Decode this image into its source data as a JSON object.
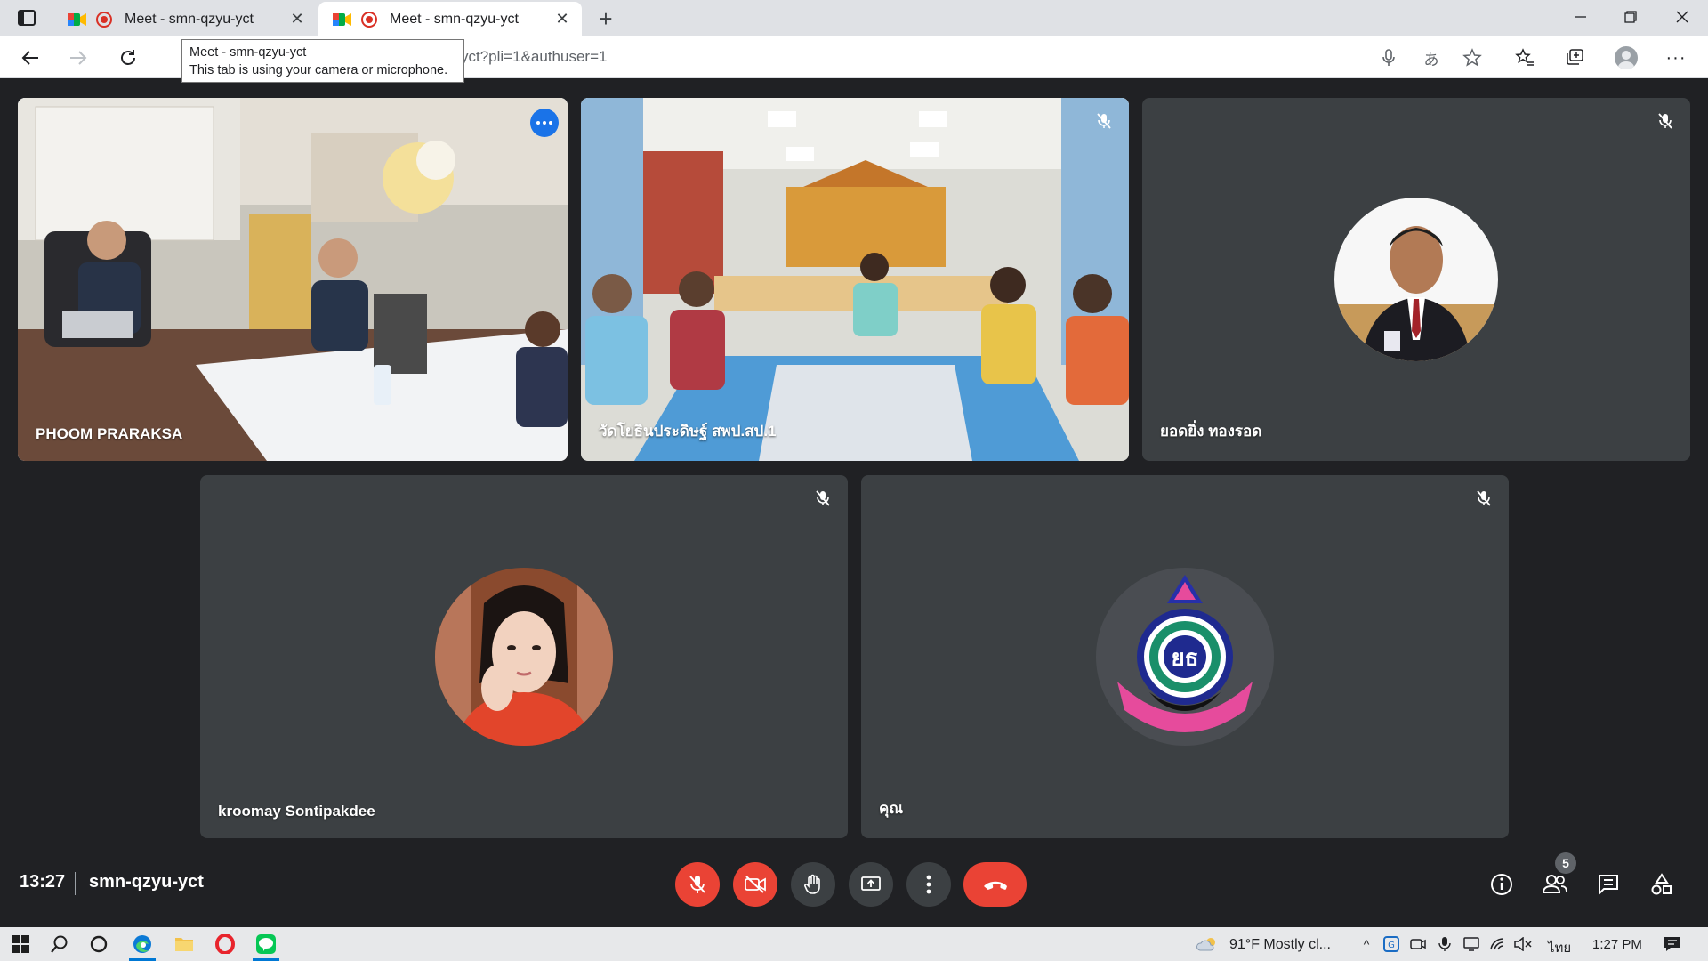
{
  "browser": {
    "tabs": [
      {
        "title": "Meet - smn-qzyu-yct",
        "active": false
      },
      {
        "title": "Meet - smn-qzyu-yct",
        "active": true
      }
    ],
    "new_tab_label": "+",
    "url_visible": "yct?pli=1&authuser=1",
    "tooltip": {
      "title": "Meet - smn-qzyu-yct",
      "text": "This tab is using your camera or microphone."
    }
  },
  "meet": {
    "participants": [
      {
        "name": "PHOOM PRARAKSA",
        "camera": "on",
        "speaking": true
      },
      {
        "name": "วัดโยธินประดิษฐ์ สพป.สป.1",
        "camera": "on",
        "muted": true
      },
      {
        "name": "ยอดยิ่ง ทองรอด",
        "camera": "off",
        "muted": true
      },
      {
        "name": "kroomay Sontipakdee",
        "camera": "off",
        "muted": true
      },
      {
        "name": "คุณ",
        "camera": "off",
        "muted": true
      }
    ],
    "clock": "13:27",
    "meeting_code": "smn-qzyu-yct",
    "participant_count": "5",
    "colors": {
      "background": "#202124",
      "tile": "#3c4043",
      "danger": "#ea4335",
      "speaking_outline": "#8ab4f8"
    }
  },
  "taskbar": {
    "weather": "91°F  Mostly cl...",
    "language": "ไทย",
    "time": "1:27 PM"
  }
}
